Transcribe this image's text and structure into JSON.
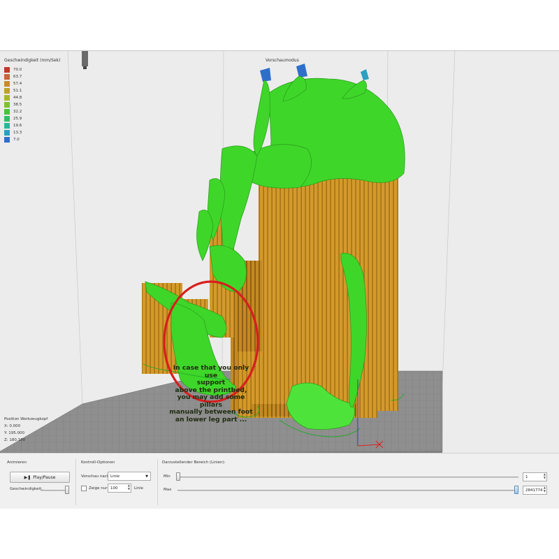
{
  "viewport": {
    "mode_label": "Vorschaumodus",
    "legend": {
      "title": "Geschwindigkeit (mm/Sek)",
      "items": [
        {
          "value": "70.0",
          "color": "#c0392b"
        },
        {
          "value": "63.7",
          "color": "#c8653a"
        },
        {
          "value": "57.4",
          "color": "#c98a2e"
        },
        {
          "value": "51.1",
          "color": "#bfa12a"
        },
        {
          "value": "44.8",
          "color": "#a7b72b"
        },
        {
          "value": "38.5",
          "color": "#7cc22d"
        },
        {
          "value": "32.2",
          "color": "#47c43a"
        },
        {
          "value": "25.9",
          "color": "#2fbf66"
        },
        {
          "value": "19.6",
          "color": "#28b79a"
        },
        {
          "value": "13.3",
          "color": "#2a9fc2"
        },
        {
          "value": "7.0",
          "color": "#2f6fc9"
        }
      ]
    },
    "position": {
      "title": "Position Werkzeugkopf",
      "x": "X: 0.000",
      "y": "Y: 195.000",
      "z": "Z: 180.180"
    },
    "annotation": [
      "In case that you only use",
      "support",
      "above the printbed,",
      "you may add some pillars",
      "manually between foot",
      "an lower leg part ..."
    ],
    "colors": {
      "support": "#d49a2a",
      "model": "#3fd62a",
      "bed": "#8f8f8f",
      "highlight_circle": "#d81e1e"
    }
  },
  "controls": {
    "animate": {
      "title": "Animieren",
      "play_label": "Play/Pause",
      "speed_label": "Geschwindigkeit:"
    },
    "options": {
      "title": "Kontroll-Optionen",
      "preview_label": "Vorschau nach",
      "preview_value": "Linie",
      "show_only_label": "Zeige nur",
      "show_only_value": "100",
      "show_only_unit": "Linie"
    },
    "range": {
      "title": "Darzustellender Bereich (Linien):",
      "min_label": "Min",
      "min_value": "1",
      "max_label": "Max",
      "max_value": "2841774"
    }
  }
}
